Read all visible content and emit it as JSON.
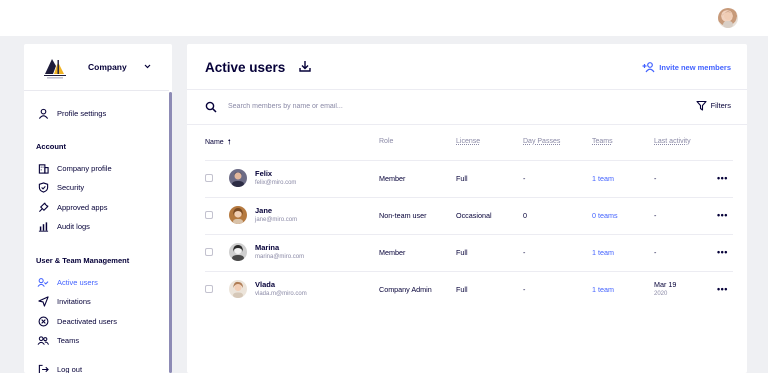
{
  "header": {
    "avatar_icon": "user-avatar"
  },
  "sidebar": {
    "company": "Company",
    "items": {
      "profile_settings": "Profile settings",
      "company_profile": "Company profile",
      "security": "Security",
      "approved_apps": "Approved apps",
      "audit_logs": "Audit logs",
      "active_users": "Active users",
      "invitations": "Invitations",
      "deactivated_users": "Deactivated users",
      "teams": "Teams",
      "log_out": "Log out"
    },
    "sections": {
      "account": "Account",
      "user_team": "User & Team Management"
    }
  },
  "main": {
    "title": "Active users",
    "invite_label": "Invite new members",
    "search_placeholder": "Search members by name or email...",
    "filters_label": "Filters",
    "columns": {
      "name": "Name",
      "role": "Role",
      "license": "License",
      "day_passes": "Day Passes",
      "teams": "Teams",
      "last_activity": "Last activity"
    },
    "users": [
      {
        "name": "Felix",
        "email": "felix@miro.com",
        "role": "Member",
        "license": "Full",
        "day_passes": "-",
        "teams": "1 team",
        "last_activity": "-",
        "last_activity_year": ""
      },
      {
        "name": "Jane",
        "email": "jane@miro.com",
        "role": "Non-team user",
        "license": "Occasional",
        "day_passes": "0",
        "teams": "0 teams",
        "last_activity": "-",
        "last_activity_year": ""
      },
      {
        "name": "Marina",
        "email": "marina@miro.com",
        "role": "Member",
        "license": "Full",
        "day_passes": "-",
        "teams": "1 team",
        "last_activity": "-",
        "last_activity_year": ""
      },
      {
        "name": "Vlada",
        "email": "vlada.m@miro.com",
        "role": "Company Admin",
        "license": "Full",
        "day_passes": "-",
        "teams": "1 team",
        "last_activity": "Mar 19",
        "last_activity_year": "2020"
      }
    ],
    "more_label": "•••"
  },
  "colors": {
    "accent": "#4262ff",
    "text": "#050038",
    "muted": "#8a89a6",
    "background": "#eff0f3"
  }
}
